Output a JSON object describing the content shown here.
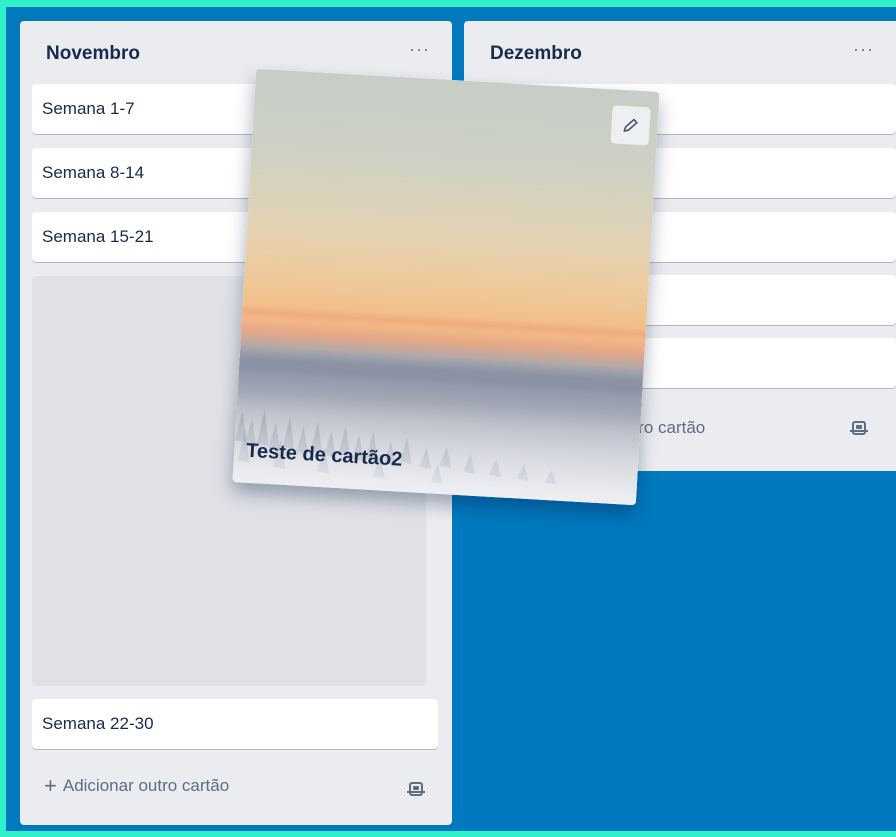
{
  "board": {
    "lists": [
      {
        "title": "Novembro",
        "menu": "···",
        "cards": [
          "Semana 1-7",
          "Semana 8-14",
          "Semana 15-21",
          "Semana 22-30"
        ],
        "add_card": "Adicionar outro cartão"
      },
      {
        "title": "Dezembro",
        "menu": "···",
        "add_card_visible": "utro cartão"
      }
    ]
  },
  "dragged_card": {
    "title": "Teste de cartão2"
  },
  "icons": {
    "menu": "more-horizontal-icon",
    "add": "plus-icon",
    "template": "card-template-icon",
    "edit": "pencil-icon"
  },
  "colors": {
    "board_bg": "#0079bf",
    "list_bg": "#ebecf0",
    "frame": "#2ff0c8"
  }
}
